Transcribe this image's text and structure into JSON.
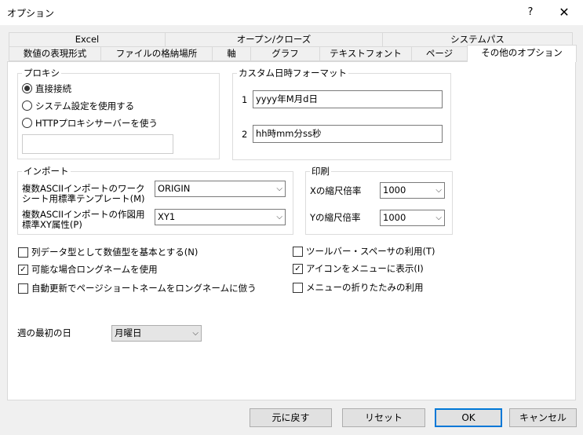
{
  "window": {
    "title": "オプション",
    "help_icon": "?",
    "close_icon": "✕"
  },
  "tabs_row1": [
    "Excel",
    "オープン/クローズ",
    "システムパス"
  ],
  "tabs_row2": [
    "数値の表現形式",
    "ファイルの格納場所",
    "軸",
    "グラフ",
    "テキストフォント",
    "ページ",
    "その他のオプション"
  ],
  "proxy": {
    "legend": "プロキシ",
    "options": [
      "直接接続",
      "システム設定を使用する",
      "HTTPプロキシサーバーを使う"
    ],
    "selected": "直接接続",
    "server_value": ""
  },
  "datetime": {
    "legend": "カスタム日時フォーマット",
    "rows": [
      {
        "num": "1",
        "value": "yyyy年M月d日"
      },
      {
        "num": "2",
        "value": "hh時mm分ss秒"
      }
    ]
  },
  "import": {
    "legend": "インポート",
    "template_label1": "複数ASCIIインポートのワーク",
    "template_label2": "シート用標準テンプレート(M)",
    "template_value": "ORIGIN",
    "xy_label1": "複数ASCIIインポートの作図用",
    "xy_label2": "標準XY属性(P)",
    "xy_value": "XY1"
  },
  "print": {
    "legend": "印刷",
    "x_label": "Xの縮尺倍率",
    "x_value": "1000",
    "y_label": "Yの縮尺倍率",
    "y_value": "1000"
  },
  "checks_left": [
    {
      "label": "列データ型として数値型を基本とする(N)",
      "checked": false
    },
    {
      "label": "可能な場合ロングネームを使用",
      "checked": true
    },
    {
      "label": "自動更新でページショートネームをロングネームに倣う",
      "checked": false
    }
  ],
  "checks_right": [
    {
      "label": "ツールバー・スペーサの利用(T)",
      "checked": false
    },
    {
      "label": "アイコンをメニューに表示(I)",
      "checked": true
    },
    {
      "label": "メニューの折りたたみの利用",
      "checked": false
    }
  ],
  "week": {
    "label": "週の最初の日",
    "value": "月曜日"
  },
  "buttons": {
    "revert": "元に戻す",
    "reset": "リセット",
    "ok": "OK",
    "cancel": "キャンセル"
  }
}
